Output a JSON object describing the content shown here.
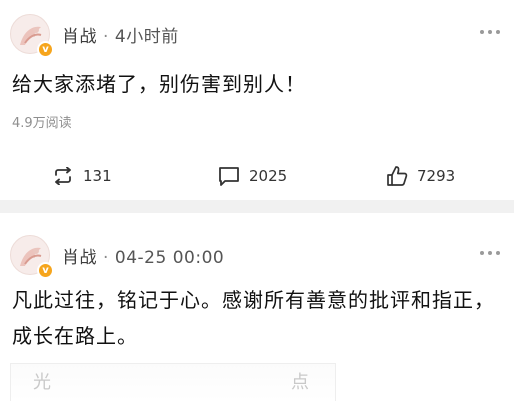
{
  "posts": [
    {
      "author": "肖战",
      "separator": "·",
      "time": "4小时前",
      "text": "给大家添堵了，别伤害到别人！",
      "reads": "4.9万阅读",
      "actions": {
        "repost": "131",
        "comment": "2025",
        "like": "7293"
      }
    },
    {
      "author": "肖战",
      "separator": "·",
      "time": "04-25 00:00",
      "text": "凡此过往，铭记于心。感谢所有善意的批评和指正，成长在路上。",
      "faded_left": "光",
      "faded_right": "点"
    }
  ],
  "colors": {
    "badge": "#f6a51d",
    "separator_bg": "#f1f1f1"
  },
  "icons": [
    "avatar-image",
    "vip-badge-icon",
    "more-icon",
    "repost-icon",
    "comment-icon",
    "like-icon"
  ]
}
